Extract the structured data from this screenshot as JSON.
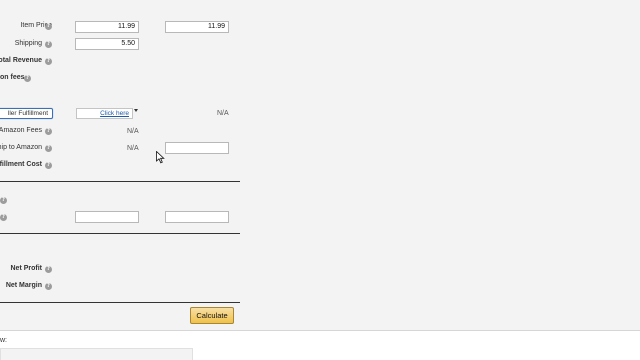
{
  "rows": {
    "item_price": {
      "label": "Item Price",
      "value1": "11.99",
      "value2": "11.99"
    },
    "shipping": {
      "label": "Shipping",
      "value1": "5.50"
    },
    "total_revenue": {
      "label": "Total Revenue"
    },
    "amazon_fees": {
      "label": "on fees"
    },
    "fulfillment": {
      "select_label": "ller Fulfillment",
      "link_text": "Click here",
      "na_right": "N/A"
    },
    "amazon_fees_row": {
      "label": "y Amazon Fees",
      "na": "N/A"
    },
    "ship_to_amazon": {
      "label": "hip to Amazon",
      "na": "N/A"
    },
    "fulfillment_cost": {
      "label": "lfillment Cost"
    },
    "net_profit": {
      "label": "Net Profit"
    },
    "net_margin": {
      "label": "Net Margin"
    }
  },
  "buttons": {
    "calculate": "Calculate"
  },
  "bottom": {
    "label": "w:"
  },
  "icons": {
    "help": "help-icon",
    "cursor": "mouse-pointer-icon"
  },
  "colors": {
    "button_top": "#f7dfa5",
    "button_bottom": "#f0c14b",
    "link": "#1e5aa8"
  }
}
